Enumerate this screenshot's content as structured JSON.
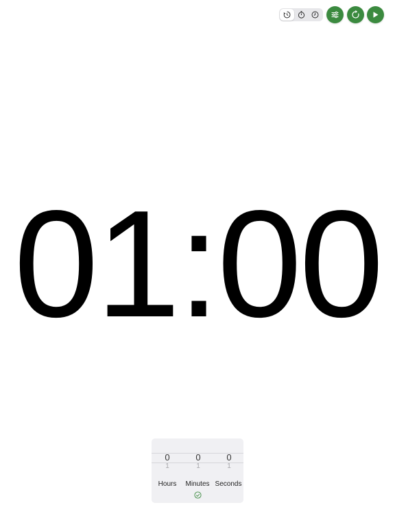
{
  "toolbar": {
    "modes": [
      {
        "icon": "timer-icon",
        "active": true
      },
      {
        "icon": "stopwatch-icon",
        "active": false
      },
      {
        "icon": "clock-icon",
        "active": false
      }
    ],
    "buttons": [
      {
        "icon": "settings-sliders-icon"
      },
      {
        "icon": "reset-icon"
      },
      {
        "icon": "play-icon"
      }
    ],
    "accent_color": "#3b8a3f"
  },
  "display": {
    "time": "01:00"
  },
  "picker": {
    "columns": [
      {
        "label": "Hours",
        "value": "0",
        "next": "1"
      },
      {
        "label": "Minutes",
        "value": "0",
        "next": "1"
      },
      {
        "label": "Seconds",
        "value": "0",
        "next": "1"
      }
    ],
    "confirm_icon": "checkmark-circle-icon"
  }
}
